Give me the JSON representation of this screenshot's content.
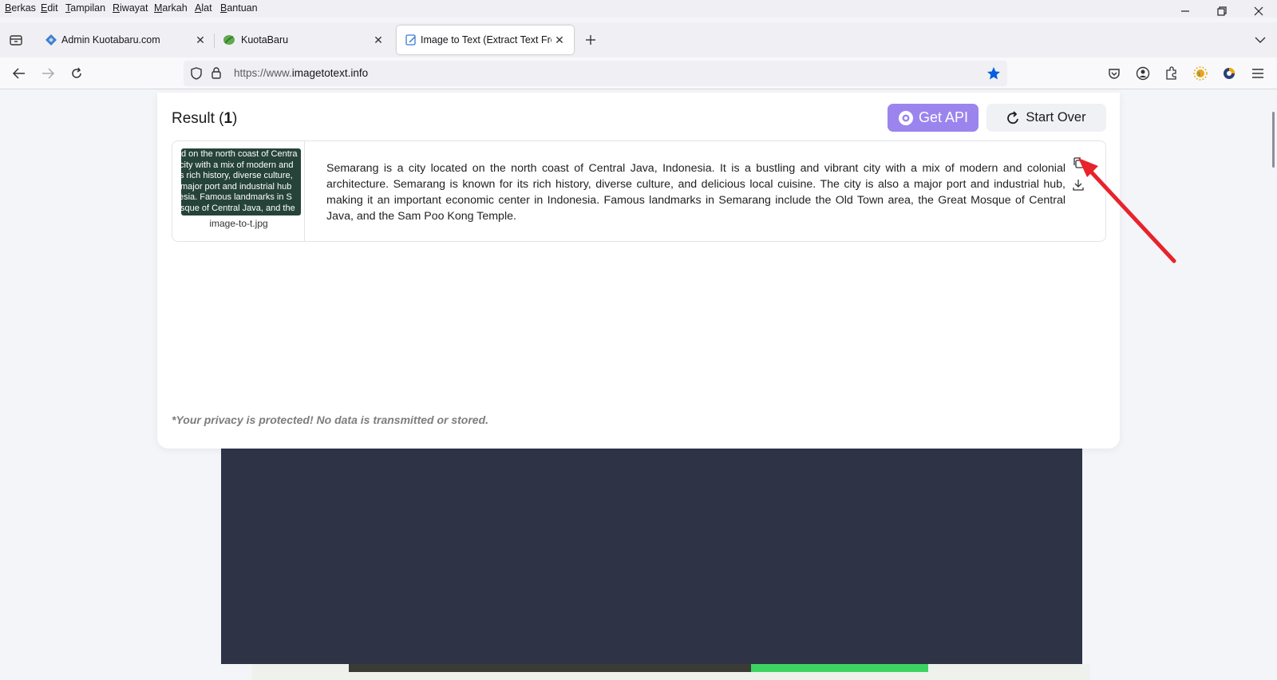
{
  "menubar": {
    "items": [
      "Berkas",
      "Edit",
      "Tampilan",
      "Riwayat",
      "Markah",
      "Alat",
      "Bantuan"
    ]
  },
  "tabs": [
    {
      "title": "Admin Kuotabaru.com",
      "favicon": "diamond-icon"
    },
    {
      "title": "KuotaBaru",
      "favicon": "leaf-icon"
    },
    {
      "title": "Image to Text (Extract Text From",
      "favicon": "edit-document-icon",
      "active": true
    }
  ],
  "navbar": {
    "url_prefix": "https://www.",
    "url_domain": "imagetotext.info"
  },
  "result": {
    "title_prefix": "Result (",
    "count": "1",
    "title_suffix": ")",
    "get_api_label": "Get API",
    "start_over_label": "Start Over",
    "thumbnail": {
      "lines": [
        "d on the north coast of Centra",
        "city with a mix of modern and",
        "s rich history, diverse culture,",
        "major port and industrial hub",
        "esia. Famous landmarks in S",
        "sque of Central Java, and the"
      ],
      "filename": "image-to-t.jpg"
    },
    "extracted_text": "Semarang is a city located on the north coast of Central Java, Indonesia. It is a bustling and vibrant city with a mix of modern and colonial architecture. Semarang is known for its rich history, diverse culture, and delicious local cuisine. The city is also a major port and industrial hub, making it an important economic center in Indonesia. Famous landmarks in Semarang include the Old Town area, the Great Mosque of Central Java, and the Sam Poo Kong Temple."
  },
  "privacy_note": "*Your privacy is protected! No data is transmitted or stored.",
  "colors": {
    "get_api_bg": "#9b84ee",
    "arrow": "#e8232b",
    "ad_bg": "#2e3446",
    "bookmark_star": "#0060df"
  }
}
